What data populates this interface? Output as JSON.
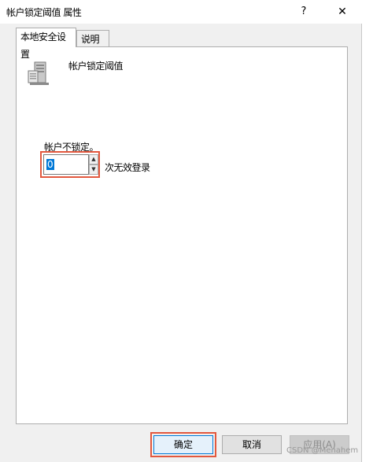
{
  "window": {
    "title": "帐户锁定阈值 属性",
    "help_label": "?",
    "close_label": "✕"
  },
  "tabs": [
    {
      "label": "本地安全设置",
      "active": true
    },
    {
      "label": "说明",
      "active": false
    }
  ],
  "policy": {
    "icon": "server-policy-icon",
    "name": "帐户锁定阈值"
  },
  "setting": {
    "status_label": "帐户不锁定。",
    "value": "0",
    "spin_up": "▲",
    "spin_down": "▼",
    "suffix": "次无效登录"
  },
  "buttons": {
    "ok": "确定",
    "cancel": "取消",
    "apply": "应用(A)"
  },
  "watermark": "CSDN @Menahem",
  "colors": {
    "highlight": "#e2583e",
    "selection": "#0078d7"
  }
}
